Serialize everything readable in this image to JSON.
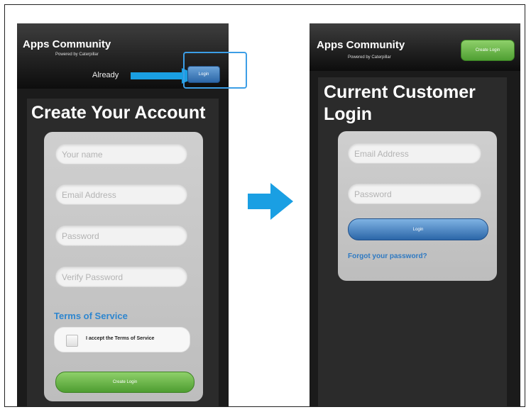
{
  "colors": {
    "accent_blue": "#2e86cf",
    "button_green": "#5fb13e",
    "button_blue": "#3a74b5",
    "arrow_blue": "#1a9fe3"
  },
  "left_screen": {
    "header": {
      "app_title": "Apps Community",
      "powered_by": "Powered by Caterpillar",
      "already_text": "Already",
      "login_button": "Login"
    },
    "title": "Create Your Account",
    "fields": [
      {
        "placeholder": "Your name"
      },
      {
        "placeholder": "Email Address"
      },
      {
        "placeholder": "Password"
      },
      {
        "placeholder": "Verify Password"
      }
    ],
    "tos_link": "Terms of Service",
    "accept_label": "I accept the Terms of Service",
    "create_button": "Create Login"
  },
  "right_screen": {
    "header": {
      "app_title": "Apps Community",
      "powered_by": "Powered by Caterpillar",
      "create_button": "Create Login"
    },
    "title": "Current Customer Login",
    "fields": [
      {
        "placeholder": "Email Address"
      },
      {
        "placeholder": "Password"
      }
    ],
    "login_button": "Login",
    "forgot_link": "Forgot your password?"
  },
  "icons": {
    "pointer_arrow": "arrow-right-icon",
    "flow_arrow": "arrow-right-icon"
  }
}
